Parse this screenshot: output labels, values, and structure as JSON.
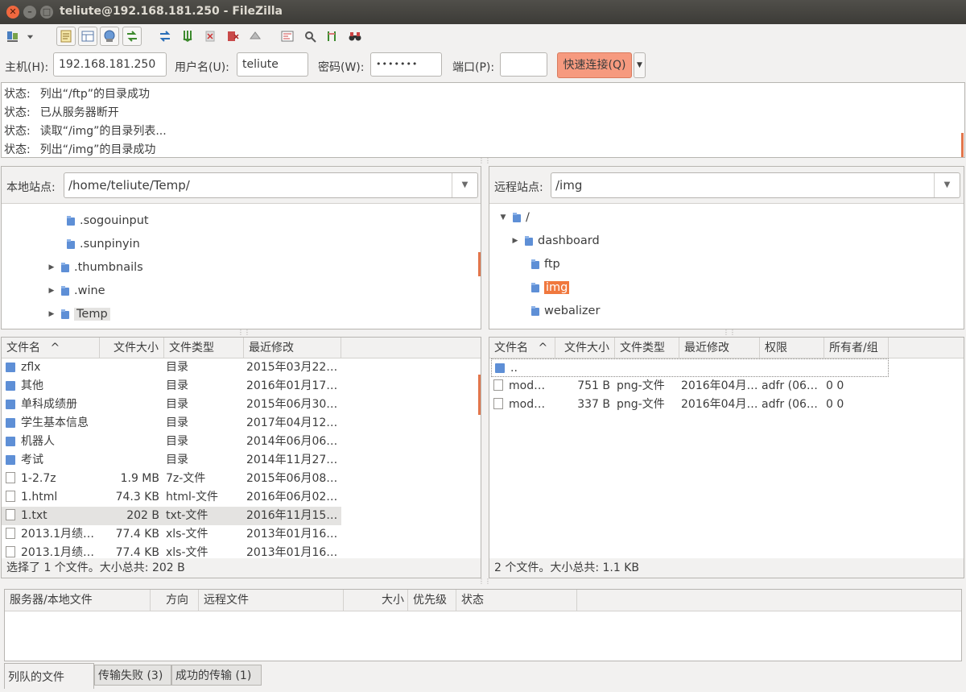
{
  "window": {
    "title": "teliute@192.168.181.250 - FileZilla",
    "close_glyph": "✕",
    "min_glyph": "–",
    "max_glyph": "□"
  },
  "toolbar": {
    "icons": [
      "site-manager-icon",
      "dropdown-arrow-icon",
      "message-log-toggle-icon",
      "local-tree-toggle-icon",
      "remote-tree-toggle-icon",
      "transfer-queue-toggle-icon",
      "refresh-icon",
      "process-queue-icon",
      "cancel-operation-icon",
      "disconnect-icon",
      "reconnect-icon",
      "filter-icon",
      "compare-icon",
      "sync-browse-icon",
      "search-icon"
    ]
  },
  "quickconnect": {
    "host_label": "主机(H):",
    "host_value": "192.168.181.250",
    "user_label": "用户名(U):",
    "user_value": "teliute",
    "pass_label": "密码(W):",
    "pass_value": "•••••••",
    "port_label": "端口(P):",
    "port_value": "",
    "connect_label": "快速连接(Q)",
    "dropdown_glyph": "▼"
  },
  "log": [
    {
      "key": "状态:",
      "msg": "列出“/ftp”的目录成功"
    },
    {
      "key": "状态:",
      "msg": "已从服务器断开"
    },
    {
      "key": "状态:",
      "msg": "读取“/img”的目录列表..."
    },
    {
      "key": "状态:",
      "msg": "列出“/img”的目录成功"
    }
  ],
  "local_site": {
    "label": "本地站点:",
    "path": "/home/teliute/Temp/",
    "tree": [
      {
        "name": ".sogouinput",
        "expander": ""
      },
      {
        "name": ".sunpinyin",
        "expander": ""
      },
      {
        "name": ".thumbnails",
        "expander": "▶"
      },
      {
        "name": ".wine",
        "expander": "▶"
      },
      {
        "name": "Temp",
        "expander": "▶"
      }
    ]
  },
  "remote_site": {
    "label": "远程站点:",
    "path": "/img",
    "tree": [
      {
        "name": "/",
        "expander": "▼"
      },
      {
        "name": "dashboard",
        "expander": "▶"
      },
      {
        "name": "ftp",
        "expander": ""
      },
      {
        "name": "img",
        "expander": ""
      },
      {
        "name": "webalizer",
        "expander": ""
      }
    ]
  },
  "local_list": {
    "headers": {
      "name": "文件名",
      "sort": "^",
      "size": "文件大小",
      "type": "文件类型",
      "modified": "最近修改"
    },
    "rows": [
      {
        "name": "zflx",
        "size": "",
        "type": "目录",
        "modified": "2015年03月22…",
        "kind": "folder"
      },
      {
        "name": "其他",
        "size": "",
        "type": "目录",
        "modified": "2016年01月17…",
        "kind": "folder"
      },
      {
        "name": "单科成绩册",
        "size": "",
        "type": "目录",
        "modified": "2015年06月30…",
        "kind": "folder"
      },
      {
        "name": "学生基本信息",
        "size": "",
        "type": "目录",
        "modified": "2017年04月12…",
        "kind": "folder"
      },
      {
        "name": "机器人",
        "size": "",
        "type": "目录",
        "modified": "2014年06月06…",
        "kind": "folder"
      },
      {
        "name": "考试",
        "size": "",
        "type": "目录",
        "modified": "2014年11月27…",
        "kind": "folder"
      },
      {
        "name": "1-2.7z",
        "size": "1.9 MB",
        "type": "7z-文件",
        "modified": "2015年06月08…",
        "kind": "file"
      },
      {
        "name": "1.html",
        "size": "74.3 KB",
        "type": "html-文件",
        "modified": "2016年06月02…",
        "kind": "file"
      },
      {
        "name": "1.txt",
        "size": "202 B",
        "type": "txt-文件",
        "modified": "2016年11月15…",
        "kind": "file"
      },
      {
        "name": "2013.1月绩…",
        "size": "77.4 KB",
        "type": "xls-文件",
        "modified": "2013年01月16…",
        "kind": "file"
      },
      {
        "name": "2013.1月绩…",
        "size": "77.4 KB",
        "type": "xls-文件",
        "modified": "2013年01月16…",
        "kind": "file"
      }
    ],
    "status": "选择了 1 个文件。大小总共: 202 B"
  },
  "remote_list": {
    "headers": {
      "name": "文件名",
      "sort": "^",
      "size": "文件大小",
      "type": "文件类型",
      "modified": "最近修改",
      "perms": "权限",
      "owner": "所有者/组"
    },
    "parent": "..",
    "rows": [
      {
        "name": "mod…",
        "size": "751 B",
        "type": "png-文件",
        "modified": "2016年04月…",
        "perms": "adfr (06…",
        "owner": "0 0"
      },
      {
        "name": "mod…",
        "size": "337 B",
        "type": "png-文件",
        "modified": "2016年04月…",
        "perms": "adfr (06…",
        "owner": "0 0"
      }
    ],
    "status": "2 个文件。大小总共: 1.1 KB"
  },
  "queue": {
    "headers": {
      "server": "服务器/本地文件",
      "direction": "方向",
      "remote": "远程文件",
      "size": "大小",
      "priority": "优先级",
      "status": "状态"
    }
  },
  "queue_tabs": [
    {
      "label": "列队的文件"
    },
    {
      "label": "传输失败 (3)"
    },
    {
      "label": "成功的传输 (1)"
    }
  ],
  "colors": {
    "accent": "#f0783e",
    "connect": "#f69a7f",
    "folder": "#5e8fd6"
  }
}
